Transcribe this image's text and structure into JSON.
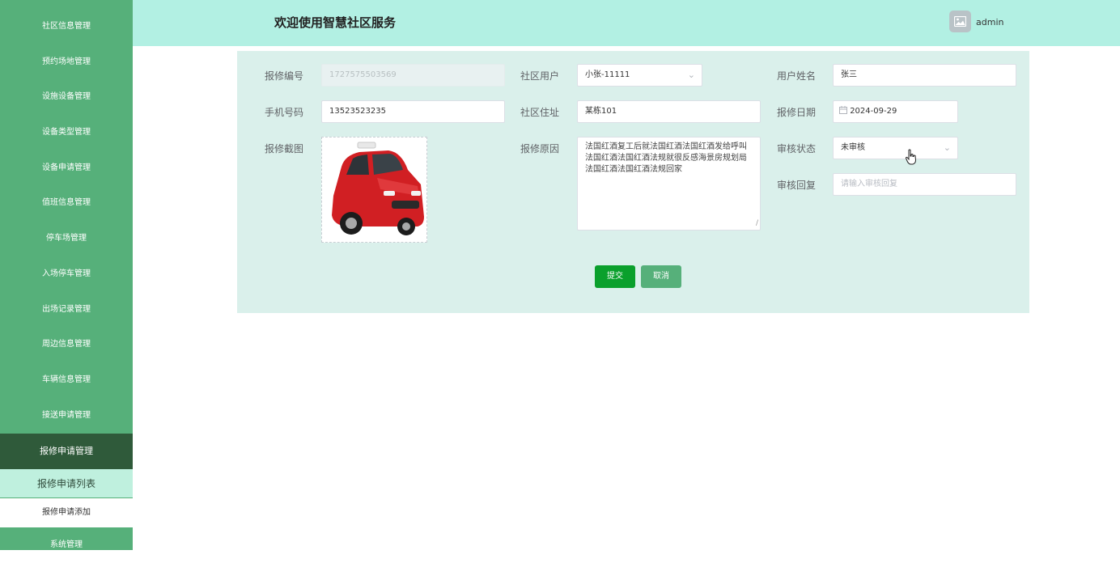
{
  "sidebar": {
    "items": [
      {
        "label": "社区信息管理"
      },
      {
        "label": "预约场地管理"
      },
      {
        "label": "设施设备管理"
      },
      {
        "label": "设备类型管理"
      },
      {
        "label": "设备申请管理"
      },
      {
        "label": "值班信息管理"
      },
      {
        "label": "停车场管理"
      },
      {
        "label": "入场停车管理"
      },
      {
        "label": "出场记录管理"
      },
      {
        "label": "周边信息管理"
      },
      {
        "label": "车辆信息管理"
      },
      {
        "label": "接送申请管理"
      },
      {
        "label": "报修申请管理"
      }
    ],
    "sub_items": [
      {
        "label": "报修申请列表"
      },
      {
        "label": "报修申请添加"
      }
    ],
    "last_item": {
      "label": "系统管理"
    }
  },
  "header": {
    "title": "欢迎使用智慧社区服务",
    "username": "admin",
    "avatar_icon": "image-icon"
  },
  "form": {
    "repair_no": {
      "label": "报修编号",
      "value": "1727575503569"
    },
    "community_user": {
      "label": "社区用户",
      "value": "小张-11111"
    },
    "user_name": {
      "label": "用户姓名",
      "value": "张三"
    },
    "phone": {
      "label": "手机号码",
      "value": "13523523235"
    },
    "address": {
      "label": "社区住址",
      "value": "某栋101"
    },
    "repair_date": {
      "label": "报修日期",
      "value": "2024-09-29"
    },
    "screenshot": {
      "label": "报修截图"
    },
    "reason": {
      "label": "报修原因",
      "value": "法国红酒复工后就法国红酒法国红酒发给呼叫法国红酒法国红酒法规就很反感海景房规划局法国红酒法国红酒法规回家"
    },
    "review_status": {
      "label": "审核状态",
      "value": "未审核"
    },
    "review_reply": {
      "label": "审核回复",
      "placeholder": "请输入审核回复"
    }
  },
  "buttons": {
    "submit": "提交",
    "cancel": "取消"
  },
  "colors": {
    "sidebar": "#56b07a",
    "sidebar_active": "#2f5a3a",
    "header": "#b2f0e3",
    "panel": "#daf0eb",
    "submit": "#0aa02c"
  }
}
